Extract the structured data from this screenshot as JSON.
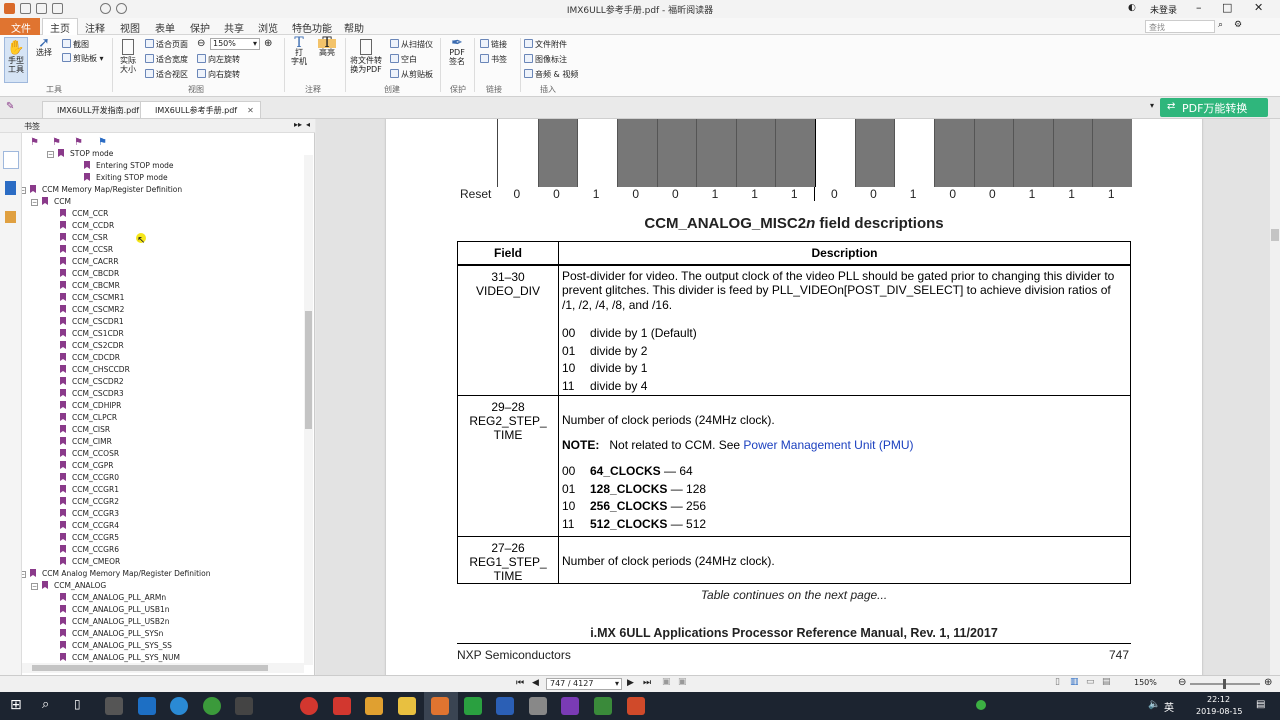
{
  "window": {
    "title": "IMX6ULL参考手册.pdf - 福昕阅读器",
    "login": "未登录",
    "search_placeholder": "查找"
  },
  "menus": [
    "文件",
    "主页",
    "注释",
    "视图",
    "表单",
    "保护",
    "共享",
    "浏览",
    "特色功能",
    "帮助"
  ],
  "ribbon": {
    "hand_tool": "手型\n工具",
    "select": "选择",
    "screenshot": "截图",
    "clipboard": "剪贴板",
    "actual_size": "实际\n大小",
    "fit_page": "适合页面",
    "fit_width": "适合宽度",
    "fit_visible": "适合视区",
    "zoom": "150%",
    "rotate_left": "向左旋转",
    "rotate_right": "向右旋转",
    "typewriter": "打\n字机",
    "highlight": "高亮",
    "convert": "将文件转\n换为PDF",
    "from_scanner": "从扫描仪",
    "blank": "空白",
    "from_clipboard": "从剪贴板",
    "pdf_sign": "PDF\n签名",
    "link": "链接",
    "bookmark": "书签",
    "file_attach": "文件附件",
    "image_annot": "图像标注",
    "audio_video": "音频 & 视频",
    "groups": [
      "工具",
      "视图",
      "注释",
      "创建",
      "保护",
      "链接",
      "插入"
    ]
  },
  "tabs": [
    {
      "label": "IMX6ULL开发指南.pdf"
    },
    {
      "label": "IMX6ULL参考手册.pdf"
    }
  ],
  "pdf_convert": "PDF万能转换",
  "sidebar": {
    "title": "书签",
    "items": [
      {
        "label": "STOP mode",
        "level": 2,
        "exp": "-"
      },
      {
        "label": "Entering STOP mode",
        "level": 3
      },
      {
        "label": "Exiting STOP mode",
        "level": 3
      },
      {
        "label": "CCM Memory Map/Register Definition",
        "level": 0,
        "exp": "-"
      },
      {
        "label": "CCM",
        "level": 1,
        "exp": "-"
      },
      {
        "label": "CCM_CCR",
        "level": 2
      },
      {
        "label": "CCM_CCDR",
        "level": 2
      },
      {
        "label": "CCM_CSR",
        "level": 2
      },
      {
        "label": "CCM_CCSR",
        "level": 2
      },
      {
        "label": "CCM_CACRR",
        "level": 2
      },
      {
        "label": "CCM_CBCDR",
        "level": 2
      },
      {
        "label": "CCM_CBCMR",
        "level": 2
      },
      {
        "label": "CCM_CSCMR1",
        "level": 2
      },
      {
        "label": "CCM_CSCMR2",
        "level": 2
      },
      {
        "label": "CCM_CSCDR1",
        "level": 2
      },
      {
        "label": "CCM_CS1CDR",
        "level": 2
      },
      {
        "label": "CCM_CS2CDR",
        "level": 2
      },
      {
        "label": "CCM_CDCDR",
        "level": 2
      },
      {
        "label": "CCM_CHSCCDR",
        "level": 2
      },
      {
        "label": "CCM_CSCDR2",
        "level": 2
      },
      {
        "label": "CCM_CSCDR3",
        "level": 2
      },
      {
        "label": "CCM_CDHIPR",
        "level": 2
      },
      {
        "label": "CCM_CLPCR",
        "level": 2
      },
      {
        "label": "CCM_CISR",
        "level": 2
      },
      {
        "label": "CCM_CIMR",
        "level": 2
      },
      {
        "label": "CCM_CCOSR",
        "level": 2
      },
      {
        "label": "CCM_CGPR",
        "level": 2
      },
      {
        "label": "CCM_CCGR0",
        "level": 2
      },
      {
        "label": "CCM_CCGR1",
        "level": 2
      },
      {
        "label": "CCM_CCGR2",
        "level": 2
      },
      {
        "label": "CCM_CCGR3",
        "level": 2
      },
      {
        "label": "CCM_CCGR4",
        "level": 2
      },
      {
        "label": "CCM_CCGR5",
        "level": 2
      },
      {
        "label": "CCM_CCGR6",
        "level": 2
      },
      {
        "label": "CCM_CMEOR",
        "level": 2
      },
      {
        "label": "CCM Analog Memory Map/Register Definition",
        "level": 0,
        "exp": "-"
      },
      {
        "label": "CCM_ANALOG",
        "level": 1,
        "exp": "-"
      },
      {
        "label": "CCM_ANALOG_PLL_ARMn",
        "level": 2
      },
      {
        "label": "CCM_ANALOG_PLL_USB1n",
        "level": 2
      },
      {
        "label": "CCM_ANALOG_PLL_USB2n",
        "level": 2
      },
      {
        "label": "CCM_ANALOG_PLL_SYSn",
        "level": 2
      },
      {
        "label": "CCM_ANALOG_PLL_SYS_SS",
        "level": 2
      },
      {
        "label": "CCM_ANALOG_PLL_SYS_NUM",
        "level": 2
      }
    ]
  },
  "page": {
    "reset_label": "Reset",
    "reset_bits": [
      "0",
      "0",
      "1",
      "0",
      "0",
      "1",
      "1",
      "1",
      "0",
      "0",
      "1",
      "0",
      "0",
      "1",
      "1",
      "1"
    ],
    "reg_shading": [
      0,
      1,
      0,
      1,
      1,
      1,
      1,
      1,
      0,
      1,
      0,
      1,
      1,
      1,
      1,
      1
    ],
    "section_title_pre": "CCM_ANALOG_MISC2",
    "section_title_n": "n",
    "section_title_post": " field descriptions",
    "col_field": "Field",
    "col_desc": "Description",
    "row1": {
      "field": "31–30\nVIDEO_DIV",
      "desc": "Post-divider for video. The output clock of the video PLL should be gated prior to changing this divider to prevent glitches. This divider is feed by PLL_VIDEOn[POST_DIV_SELECT] to achieve division ratios of /1, /2, /4, /8, and /16.",
      "opts": [
        [
          "00",
          "divide by 1 (Default)"
        ],
        [
          "01",
          "divide by 2"
        ],
        [
          "10",
          "divide by 1"
        ],
        [
          "11",
          "divide by 4"
        ]
      ]
    },
    "row2": {
      "field": "29–28\nREG2_STEP_\nTIME",
      "desc": "Number of clock periods (24MHz clock).",
      "note_label": "NOTE:",
      "note_text": "Not related to CCM. See ",
      "note_link": "Power Management Unit (PMU)",
      "opts": [
        [
          "00",
          "64_CLOCKS",
          "— 64"
        ],
        [
          "01",
          "128_CLOCKS",
          "— 128"
        ],
        [
          "10",
          "256_CLOCKS",
          "— 256"
        ],
        [
          "11",
          "512_CLOCKS",
          "— 512"
        ]
      ]
    },
    "row3": {
      "field": "27–26\nREG1_STEP_\nTIME",
      "desc": "Number of clock periods (24MHz clock)."
    },
    "continues": "Table continues on the next page...",
    "footer_title": "i.MX 6ULL Applications Processor Reference Manual, Rev. 1, 11/2017",
    "footer_left": "NXP Semiconductors",
    "footer_page": "747"
  },
  "status": {
    "page": "747 / 4127",
    "zoom": "150%"
  },
  "clock": {
    "time": "22:12",
    "date": "2019-08-15",
    "ime": "英"
  }
}
